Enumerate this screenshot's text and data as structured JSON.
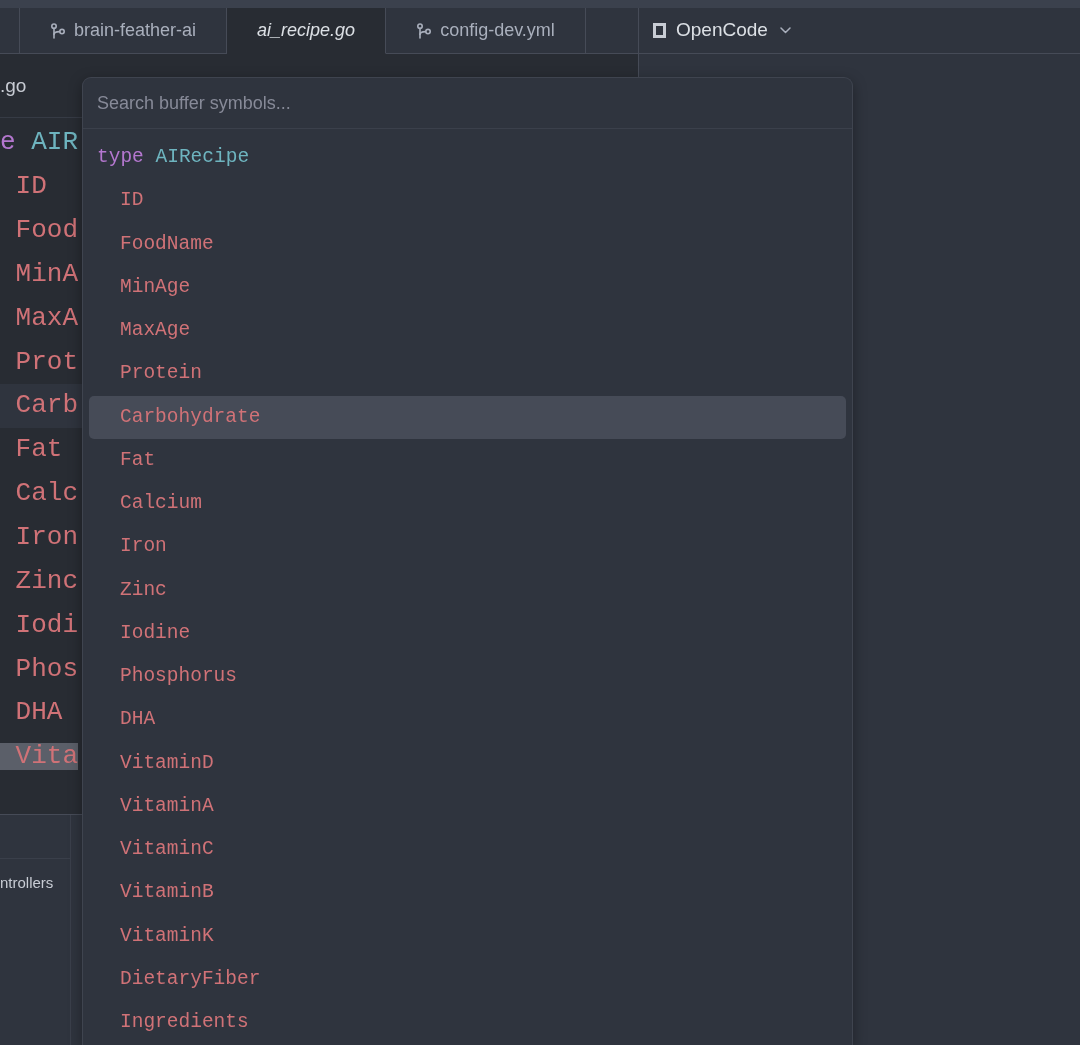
{
  "tab_bar": {
    "tabs": [
      {
        "label": "brain-feather-ai",
        "kind": "branch",
        "selected": false
      },
      {
        "label": "ai_recipe.go",
        "kind": "preview",
        "selected": true
      },
      {
        "label": "config-dev.yml",
        "kind": "branch",
        "selected": false
      }
    ]
  },
  "pane_tab": {
    "label": "OpenCode"
  },
  "breadcrumb": ".go",
  "editor": {
    "lines": [
      {
        "kind": "type",
        "keyword": "e",
        "name": "AIR",
        "current": false,
        "selected": false
      },
      {
        "kind": "field",
        "name": "ID",
        "current": false,
        "selected": false
      },
      {
        "kind": "field",
        "name": "Food",
        "current": false,
        "selected": false
      },
      {
        "kind": "field",
        "name": "MinA",
        "current": false,
        "selected": false
      },
      {
        "kind": "field",
        "name": "MaxA",
        "current": false,
        "selected": false
      },
      {
        "kind": "field",
        "name": "Prot",
        "current": false,
        "selected": false
      },
      {
        "kind": "field",
        "name": "Carb",
        "current": true,
        "selected": false
      },
      {
        "kind": "field",
        "name": "Fat",
        "current": false,
        "selected": false
      },
      {
        "kind": "field",
        "name": "Calc",
        "current": false,
        "selected": false
      },
      {
        "kind": "field",
        "name": "Iron",
        "current": false,
        "selected": false
      },
      {
        "kind": "field",
        "name": "Zinc",
        "current": false,
        "selected": false
      },
      {
        "kind": "field",
        "name": "Iodi",
        "current": false,
        "selected": false
      },
      {
        "kind": "field",
        "name": "Phos",
        "current": false,
        "selected": false
      },
      {
        "kind": "field",
        "name": "DHA",
        "current": false,
        "selected": false
      },
      {
        "kind": "field",
        "name": "Vita",
        "current": false,
        "selected": true
      }
    ]
  },
  "bottom_panel": {
    "item": "ntrollers"
  },
  "symbol_picker": {
    "search": {
      "placeholder": "Search buffer symbols..."
    },
    "items": [
      {
        "kind": "type",
        "keyword": "type",
        "name": "AIRecipe",
        "selected": false,
        "children": [
          {
            "kind": "field",
            "name": "ID",
            "selected": false
          },
          {
            "kind": "field",
            "name": "FoodName",
            "selected": false
          },
          {
            "kind": "field",
            "name": "MinAge",
            "selected": false
          },
          {
            "kind": "field",
            "name": "MaxAge",
            "selected": false
          },
          {
            "kind": "field",
            "name": "Protein",
            "selected": false
          },
          {
            "kind": "field",
            "name": "Carbohydrate",
            "selected": true
          },
          {
            "kind": "field",
            "name": "Fat",
            "selected": false
          },
          {
            "kind": "field",
            "name": "Calcium",
            "selected": false
          },
          {
            "kind": "field",
            "name": "Iron",
            "selected": false
          },
          {
            "kind": "field",
            "name": "Zinc",
            "selected": false
          },
          {
            "kind": "field",
            "name": "Iodine",
            "selected": false
          },
          {
            "kind": "field",
            "name": "Phosphorus",
            "selected": false
          },
          {
            "kind": "field",
            "name": "DHA",
            "selected": false
          },
          {
            "kind": "field",
            "name": "VitaminD",
            "selected": false
          },
          {
            "kind": "field",
            "name": "VitaminA",
            "selected": false
          },
          {
            "kind": "field",
            "name": "VitaminC",
            "selected": false
          },
          {
            "kind": "field",
            "name": "VitaminB",
            "selected": false
          },
          {
            "kind": "field",
            "name": "VitaminK",
            "selected": false
          },
          {
            "kind": "field",
            "name": "DietaryFiber",
            "selected": false
          },
          {
            "kind": "field",
            "name": "Ingredients",
            "selected": false
          }
        ]
      }
    ]
  }
}
